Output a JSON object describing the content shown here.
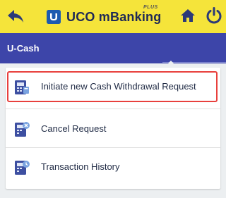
{
  "header": {
    "title": "UCO mBanking",
    "plus": "PLUS",
    "back_icon": "back-arrow-icon",
    "home_icon": "home-icon",
    "power_icon": "power-icon",
    "bg_color": "#f5e43a"
  },
  "subheader": {
    "title": "U-Cash",
    "bg_color": "#3d45a9"
  },
  "menu": {
    "items": [
      {
        "label": "Initiate new Cash Withdrawal Request",
        "icon": "cash-withdrawal-icon",
        "highlighted": true
      },
      {
        "label": "Cancel Request",
        "icon": "cancel-request-icon",
        "highlighted": false
      },
      {
        "label": "Transaction History",
        "icon": "transaction-history-icon",
        "highlighted": false
      }
    ]
  }
}
